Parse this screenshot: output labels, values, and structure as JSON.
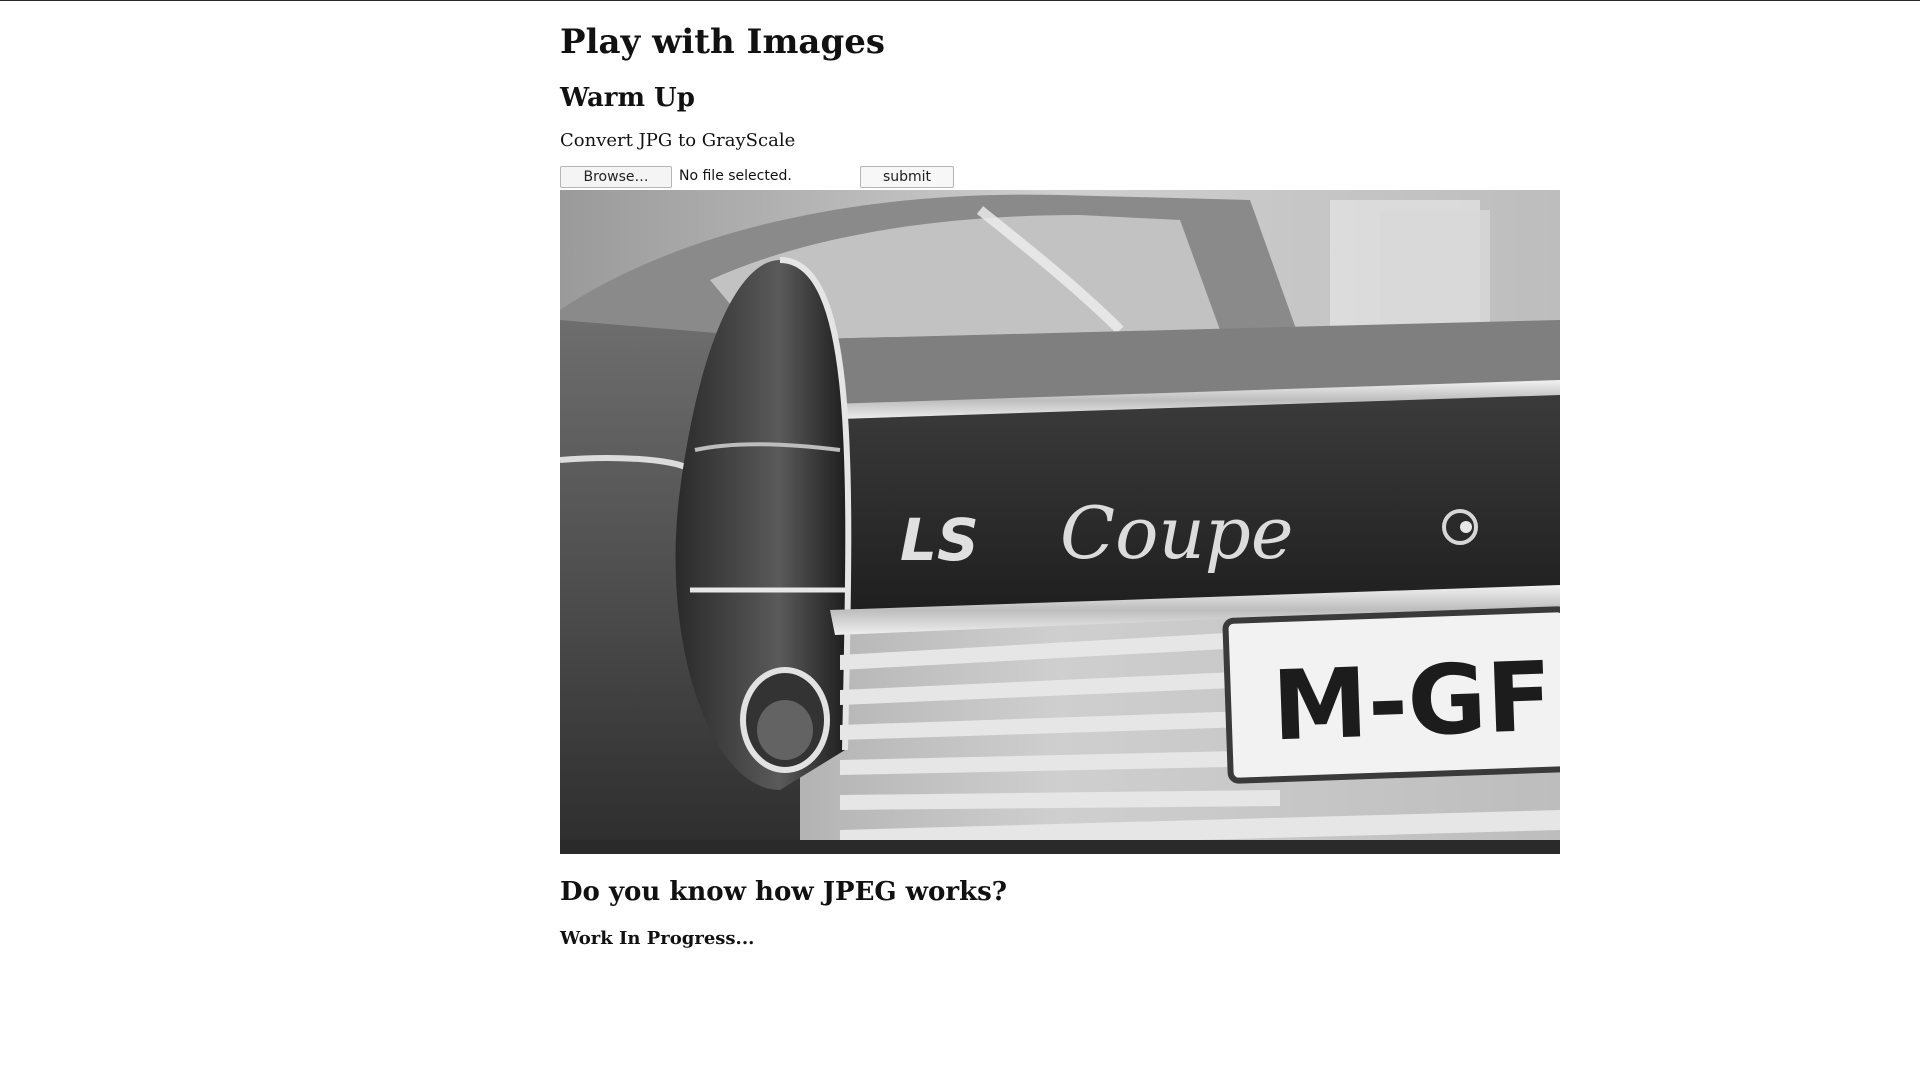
{
  "page": {
    "title": "Play with Images"
  },
  "warmup": {
    "heading": "Warm Up",
    "description": "Convert JPG to GrayScale",
    "browse_label": "Browse…",
    "file_status": "No file selected.",
    "submit_label": "submit"
  },
  "image": {
    "emblem_text": "LS",
    "script_text": "Coupe",
    "plate_text": "M-GF"
  },
  "jpeg_section": {
    "heading": "Do you know how JPEG works?",
    "status": "Work In Progress..."
  }
}
